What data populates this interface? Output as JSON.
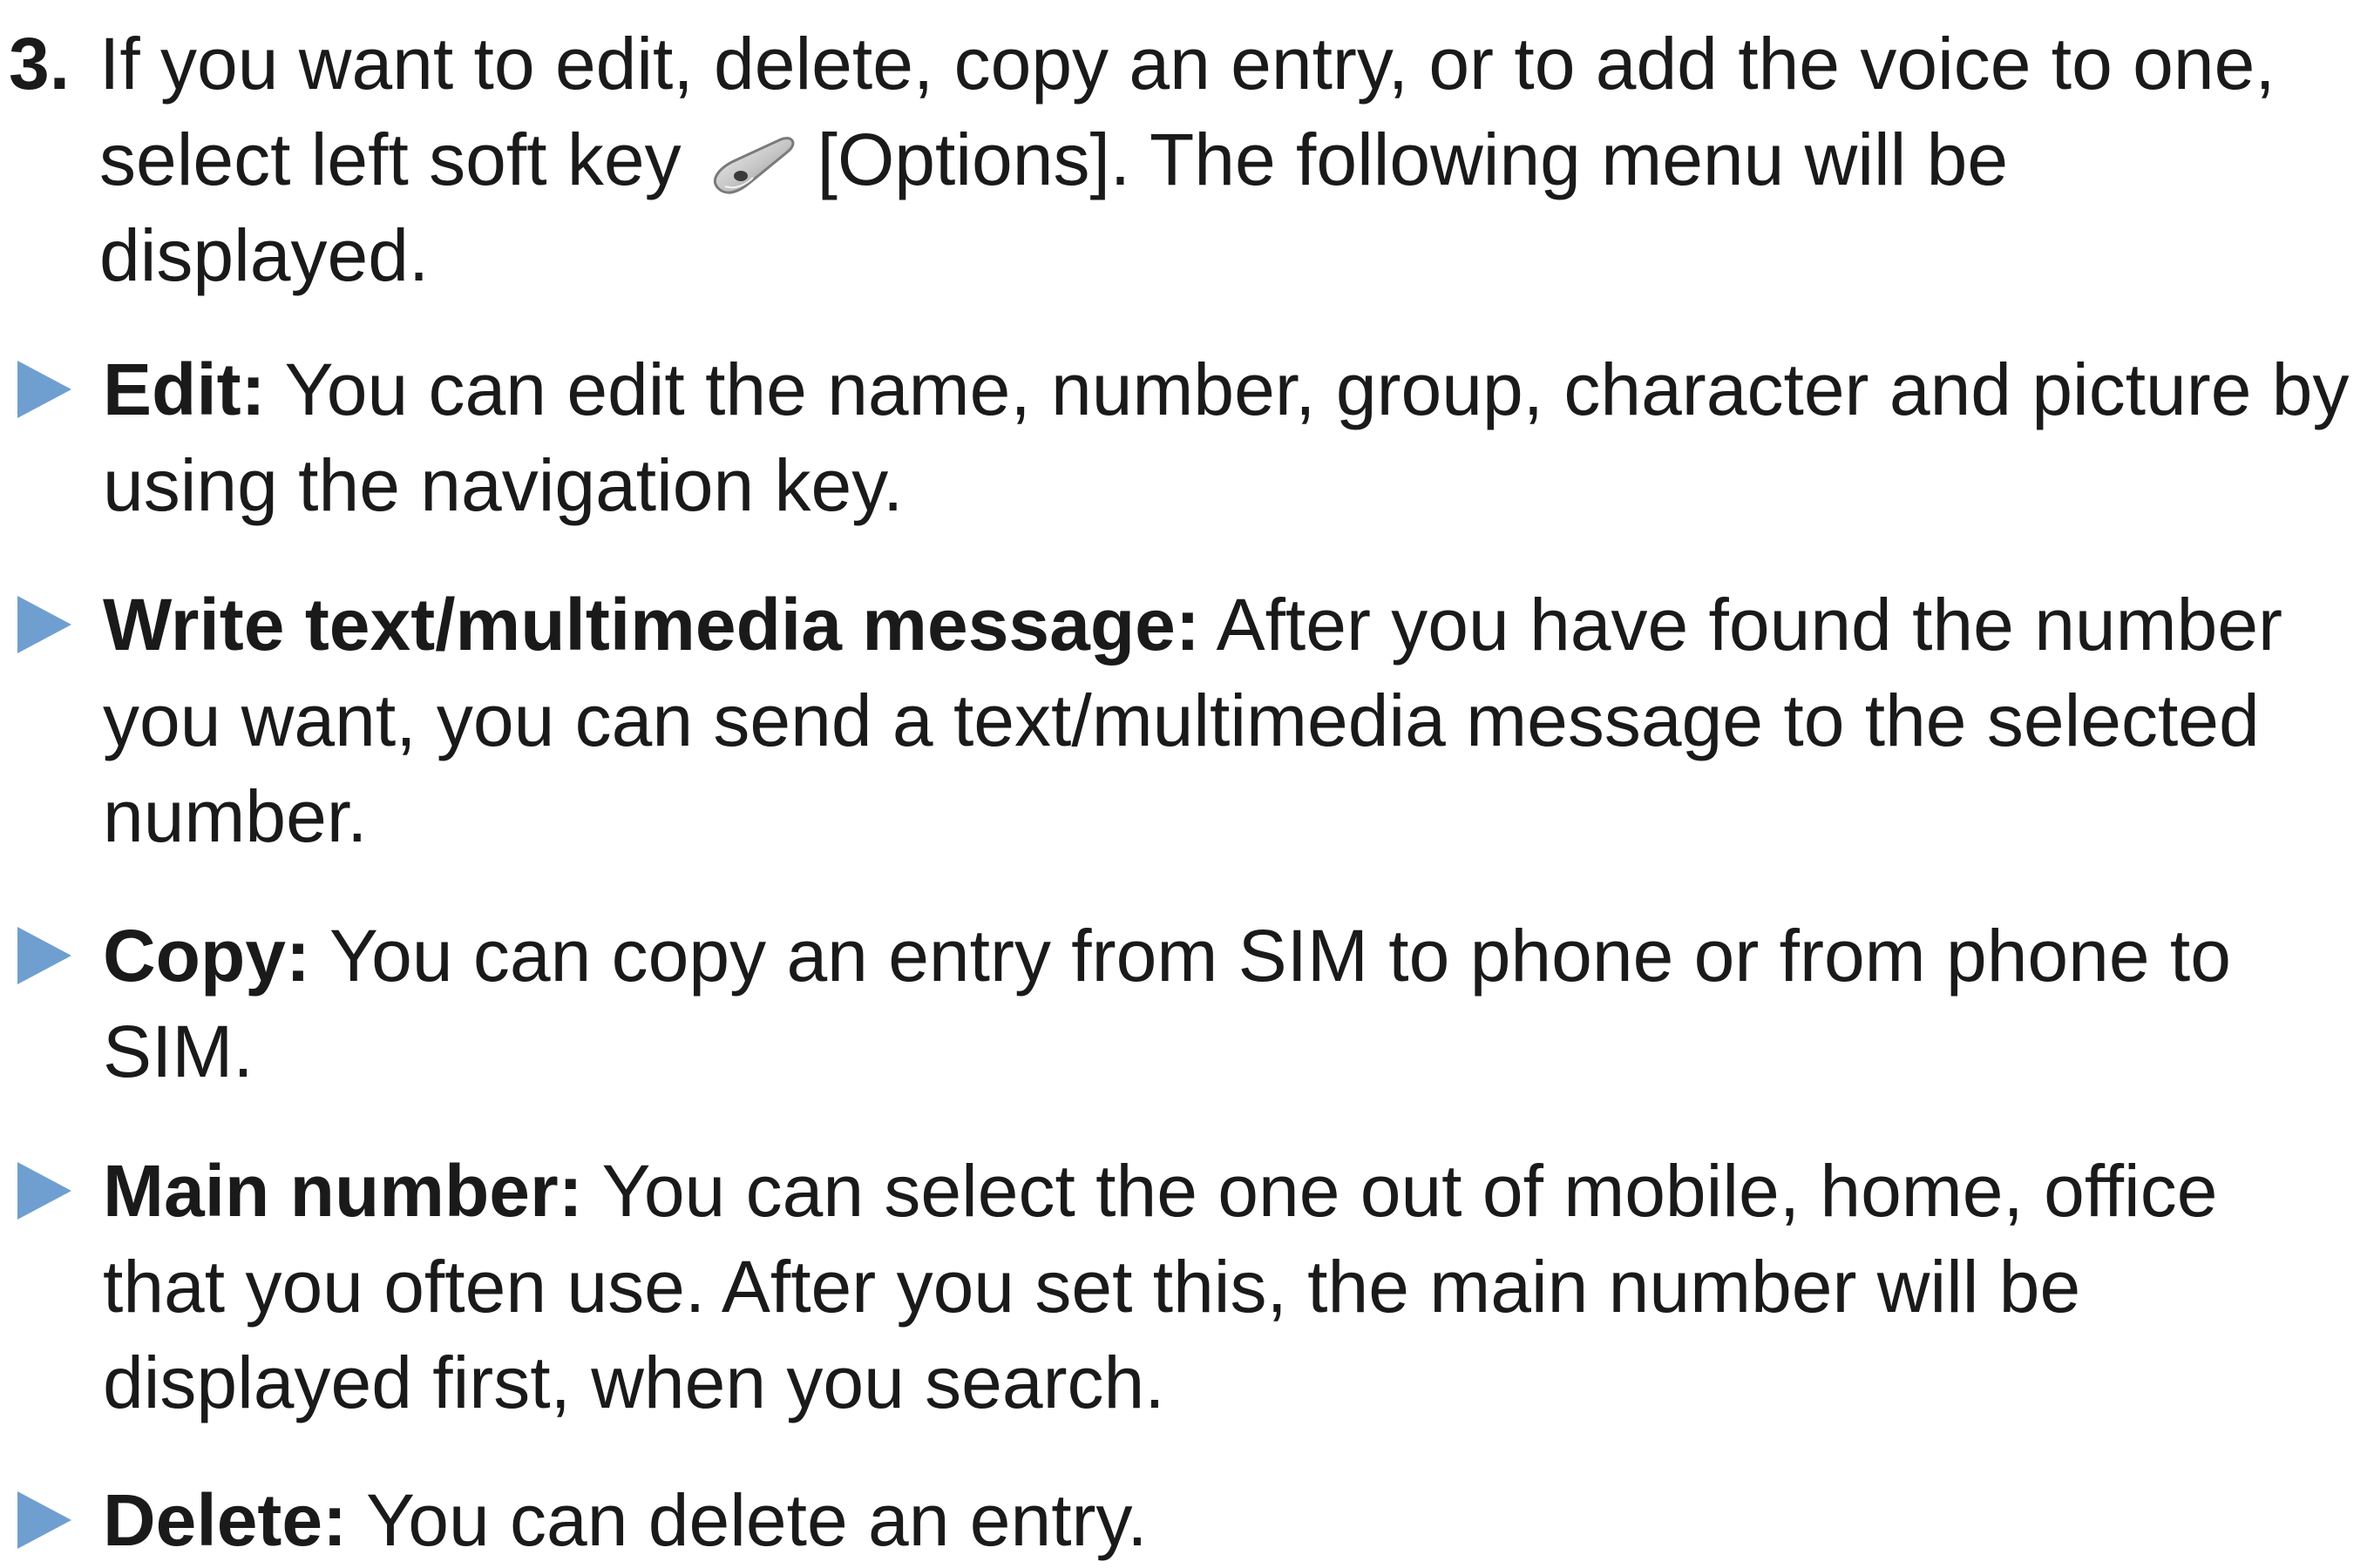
{
  "step": {
    "number": "3.",
    "text_before_icon": "If you want to edit, delete, copy an entry, or to add the voice to one, select left soft key",
    "icon": "left-soft-key-icon",
    "text_after_icon": "[Options]. The following menu will be displayed."
  },
  "bullets": [
    {
      "term": "Edit:",
      "description": "You can edit the name, number, group, character and picture by using the navigation key."
    },
    {
      "term": "Write text/multimedia message:",
      "description": "After you have found the number you want, you can send a text/multimedia message to the selected number."
    },
    {
      "term": "Copy:",
      "description": "You can copy an entry from SIM to phone or from phone to SIM."
    },
    {
      "term": "Main number:",
      "description": "You can select the one out of mobile, home, office that you often use. After you set this, the main number will be displayed first, when you search."
    },
    {
      "term": "Delete:",
      "description": "You can delete an entry."
    }
  ],
  "colors": {
    "bullet_arrow": "#6f9fd0",
    "text": "#1a1a1a"
  }
}
